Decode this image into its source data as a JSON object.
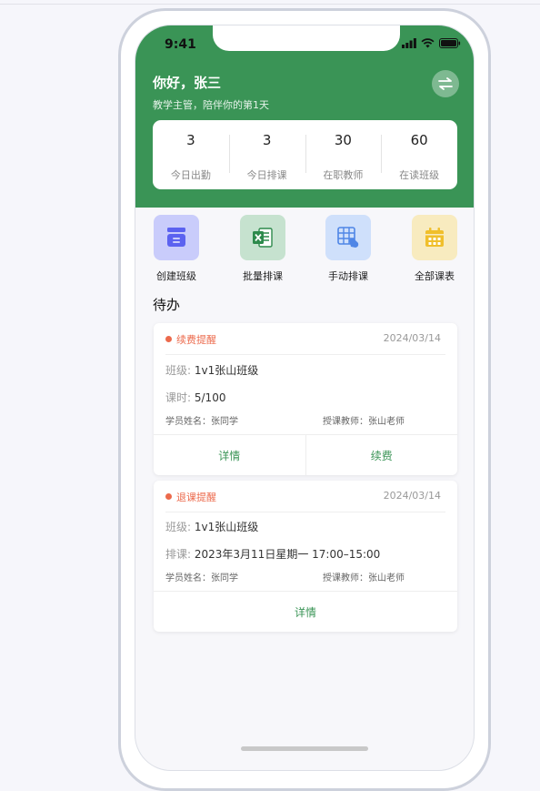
{
  "status": {
    "time": "9:41"
  },
  "header": {
    "greeting": "你好，张三",
    "subtitle": "教学主管，陪伴你的第1天",
    "switch_icon": "swap-arrows-icon"
  },
  "stats": [
    {
      "value": "3",
      "label": "今日出勤"
    },
    {
      "value": "3",
      "label": "今日排课"
    },
    {
      "value": "30",
      "label": "在职教师"
    },
    {
      "value": "60",
      "label": "在读班级"
    }
  ],
  "quick_actions": [
    {
      "label": "创建班级",
      "icon": "class-icon",
      "bg": "#c9ccfb",
      "fg": "#5b62f0"
    },
    {
      "label": "批量排课",
      "icon": "excel-icon",
      "bg": "#c6e2cf",
      "fg": "#2d8a4c"
    },
    {
      "label": "手动排课",
      "icon": "manual-schedule-icon",
      "bg": "#cfe0fb",
      "fg": "#4f86e6"
    },
    {
      "label": "全部课表",
      "icon": "calendar-icon",
      "bg": "#f8ebbf",
      "fg": "#f0bf2b"
    }
  ],
  "todo": {
    "title": "待办",
    "cards": [
      {
        "tag": "续费提醒",
        "date": "2024/03/14",
        "class_key": "班级:",
        "class_val": "1v1张山班级",
        "second_key": "课时:",
        "second_val": "5/100",
        "student": "学员姓名：张同学",
        "teacher": "授课教师：张山老师",
        "btn_detail": "详情",
        "btn_renew": "续费"
      },
      {
        "tag": "退课提醒",
        "date": "2024/03/14",
        "class_key": "班级:",
        "class_val": "1v1张山班级",
        "second_key": "排课:",
        "second_val": "2023年3月11日星期一 17:00–15:00",
        "student": "学员姓名：张同学",
        "teacher": "授课教师：张山老师",
        "btn_detail": "详情"
      }
    ]
  },
  "colors": {
    "brand": "#3a9456",
    "alert": "#ec6a4c"
  }
}
